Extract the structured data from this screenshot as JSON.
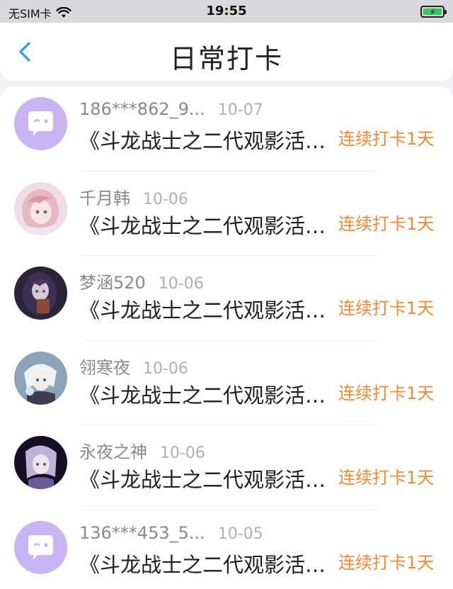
{
  "status_bar": {
    "carrier": "无SIM卡",
    "time": "19:55"
  },
  "nav": {
    "title": "日常打卡"
  },
  "colors": {
    "accent": "#2f9bea",
    "streak": "#f08a3a",
    "avatar_default": "#c9b5f4"
  },
  "items": [
    {
      "name": "186***862_9...",
      "date": "10-07",
      "title": "《斗龙战士之二代观影活动》",
      "streak": "连续打卡1天",
      "avatar": "default-chat-avatar"
    },
    {
      "name": "千月韩",
      "date": "10-06",
      "title": "《斗龙战士之二代观影活动》",
      "streak": "连续打卡1天",
      "avatar": "anime-avatar-pink"
    },
    {
      "name": "梦涵520",
      "date": "10-06",
      "title": "《斗龙战士之二代观影活动》",
      "streak": "连续打卡1天",
      "avatar": "anime-avatar-dark"
    },
    {
      "name": "翎寒夜",
      "date": "10-06",
      "title": "《斗龙战士之二代观影活动》",
      "streak": "连续打卡1天",
      "avatar": "anime-avatar-white"
    },
    {
      "name": "永夜之神",
      "date": "10-06",
      "title": "《斗龙战士之二代观影活动》",
      "streak": "连续打卡1天",
      "avatar": "anime-avatar-night"
    },
    {
      "name": "136***453_5...",
      "date": "10-05",
      "title": "《斗龙战士之二代观影活动》",
      "streak": "连续打卡1天",
      "avatar": "default-chat-avatar"
    }
  ]
}
